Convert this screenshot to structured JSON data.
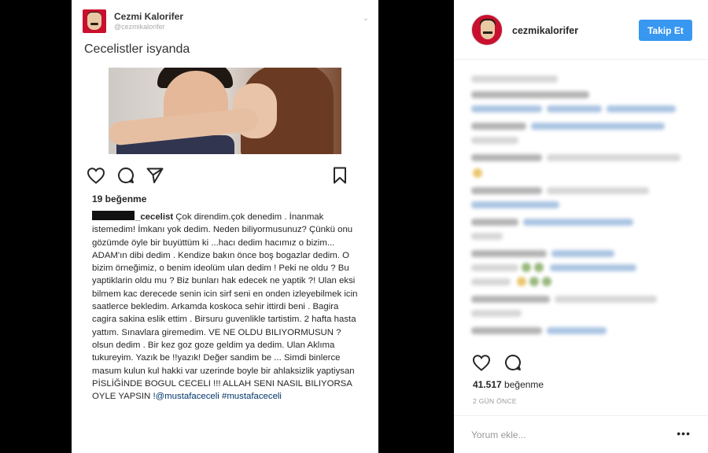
{
  "post": {
    "tweet": {
      "author_name": "Cezmi Kalorifer",
      "author_handle": "@cezmikalorifer",
      "text": "Cecelistler isyanda"
    },
    "likes": "19 beğenme",
    "comment": {
      "username": "_cecelist",
      "text": " Çok direndim.çok denedim . İnanmak istemedim! İmkanı yok dedim. Neden biliyormusunuz? Çünkü onu gözümde öyle bir buyüttüm ki ...hacı dedim hacımız o bizim... ADAM'ın dibi dedim . Kendize bakın önce boş bogazlar dedim. O bizim örneğimiz, o benim ideolüm ulan dedim ! Peki ne oldu ? Bu yaptiklarin oldu mu ? Biz bunları hak edecek ne yaptik ?! Ulan eksi bilmem kac derecede senin icin sirf seni en onden izleyebilmek icin saatlerce bekledim. Arkamda koskoca sehir ittirdi beni . Bagira cagira sakina eslik ettim . Birsuru guvenlikle tartistim. 2 hafta hasta yattım. Sınavlara giremedim. VE NE OLDU BILIYORMUSUN ? olsun dedim . Bir kez goz goze geldim ya dedim. Ulan Aklıma tukureyim. Yazık be !!yazık!  Değer sandim be ... Simdi binlerce masum kulun kul hakki var uzerinde boyle bir ahlaksizlik yaptiysan PİSLİĞİNDE BOGUL CECELI !!! ALLAH SENI NASIL BILIYORSA OYLE YAPSIN ",
      "hashtags": "!@mustafaceceli #mustafaceceli"
    }
  },
  "sidebar": {
    "username": "cezmikalorifer",
    "follow_label": "Takip Et",
    "likes_count": "41.517",
    "likes_word": "beğenme",
    "date": "2 GÜN ÖNCE",
    "comment_placeholder": "Yorum ekle...",
    "more_label": "•••"
  },
  "icons": {
    "heart": "heart-icon",
    "comment": "comment-icon",
    "share": "send-icon",
    "bookmark": "bookmark-icon",
    "more": "more-options-icon"
  },
  "colors": {
    "follow_button": "#3897f0",
    "hashtag": "#003569",
    "tweet_avatar": "#c8102e"
  }
}
